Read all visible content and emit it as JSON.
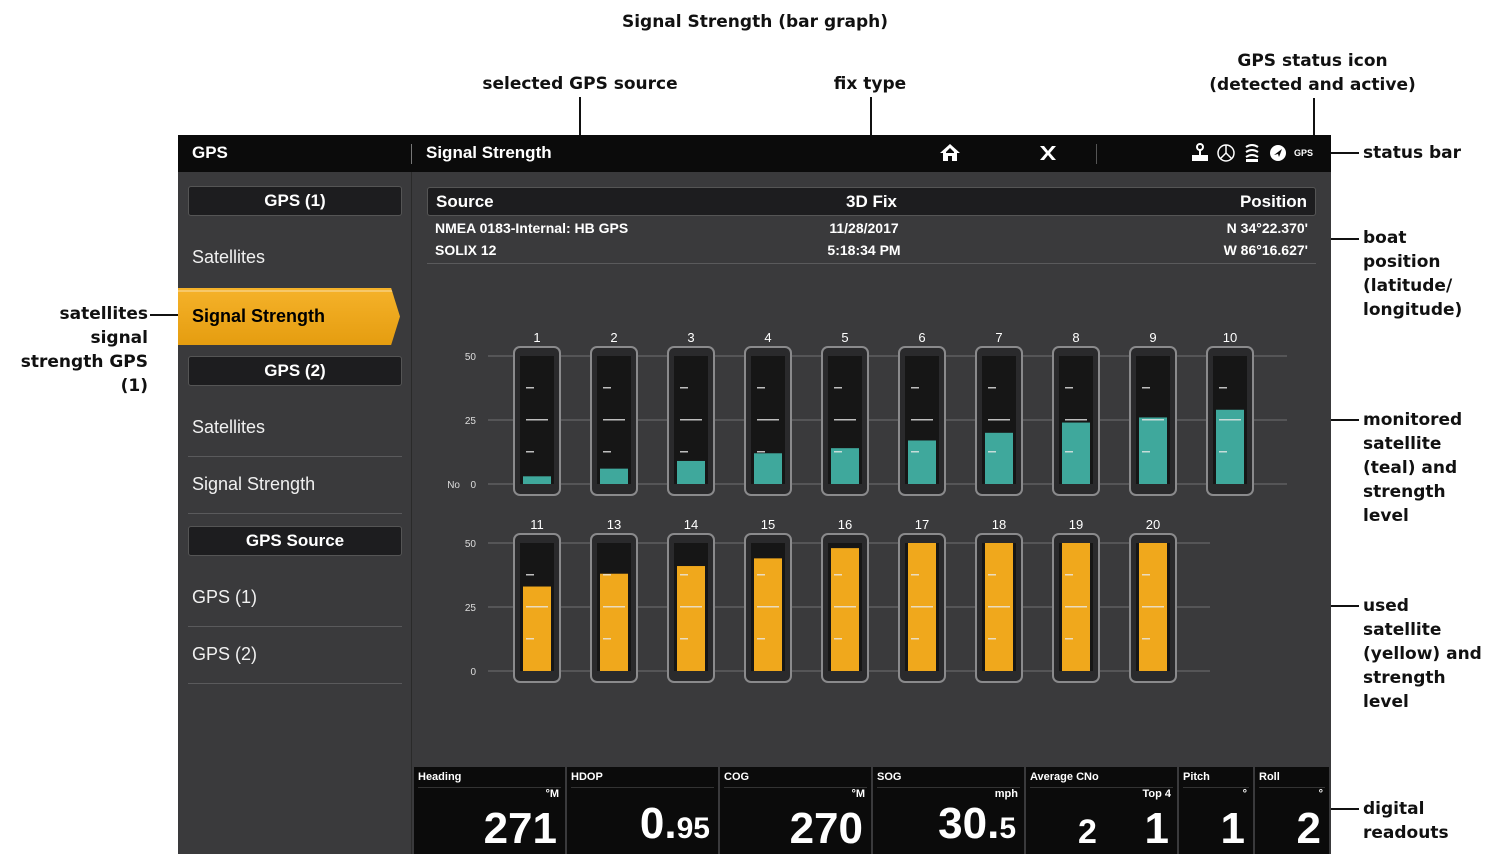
{
  "annotations": {
    "title": "Signal Strength (bar graph)",
    "selected_source": "selected GPS source",
    "fix_type": "fix type",
    "gps_status_icon_l1": "GPS status icon",
    "gps_status_icon_l2": "(detected and active)",
    "status_bar": "status bar",
    "boat_position": [
      "boat",
      "position",
      "(latitude/",
      "longitude)"
    ],
    "satellites_signal": [
      "satellites signal",
      "strength GPS (1)"
    ],
    "monitored": [
      "monitored",
      "satellite",
      "(teal) and",
      "strength",
      "level"
    ],
    "used": [
      "used satellite",
      "(yellow) and",
      "strength level"
    ],
    "digital": [
      "digital",
      "readouts"
    ]
  },
  "topbar": {
    "app": "GPS",
    "page": "Signal Strength",
    "gps_icon_text": "GPS"
  },
  "sidebar": {
    "gps1_header": "GPS (1)",
    "gps1_satellites": "Satellites",
    "gps1_signal": "Signal Strength",
    "gps2_header": "GPS (2)",
    "gps2_satellites": "Satellites",
    "gps2_signal": "Signal Strength",
    "source_header": "GPS Source",
    "source_gps1": "GPS (1)",
    "source_gps2": "GPS (2)"
  },
  "info": {
    "source_label": "Source",
    "fix": "3D Fix",
    "position_label": "Position",
    "source_name": "NMEA 0183-Internal: HB GPS",
    "device": "SOLIX 12",
    "date": "11/28/2017",
    "time": "5:18:34 PM",
    "lat": "N 34°22.370'",
    "lon": "W 86°16.627'"
  },
  "chart_data": {
    "type": "bar",
    "ylabel": "CNo",
    "yticks": [
      "50",
      "25",
      "0"
    ],
    "ylim": [
      0,
      50
    ],
    "colors": {
      "monitored": "#3fa89c",
      "used": "#f0a81c"
    },
    "rows": [
      {
        "status": "monitored",
        "categories": [
          "1",
          "2",
          "3",
          "4",
          "5",
          "6",
          "7",
          "8",
          "9",
          "10"
        ],
        "values": [
          3,
          6,
          9,
          12,
          14,
          17,
          20,
          24,
          26,
          29
        ]
      },
      {
        "status": "used",
        "categories": [
          "11",
          "13",
          "14",
          "15",
          "16",
          "17",
          "18",
          "19",
          "20"
        ],
        "values": [
          33,
          38,
          41,
          44,
          48,
          50,
          50,
          50,
          50
        ]
      }
    ]
  },
  "readouts": [
    {
      "label": "Heading",
      "unit": "°M",
      "value": "271",
      "small": ""
    },
    {
      "label": "HDOP",
      "unit": "",
      "value": "0.",
      "small": "95"
    },
    {
      "label": "COG",
      "unit": "°M",
      "value": "270",
      "small": ""
    },
    {
      "label": "SOG",
      "unit": "mph",
      "value": "30.",
      "small": "5"
    },
    {
      "label": "Average CNo",
      "unit": "Top 4",
      "value": "1",
      "sub": "2"
    },
    {
      "label": "Pitch",
      "unit": "°",
      "value": "1",
      "small": ""
    },
    {
      "label": "Roll",
      "unit": "°",
      "value": "2",
      "small": ""
    }
  ]
}
